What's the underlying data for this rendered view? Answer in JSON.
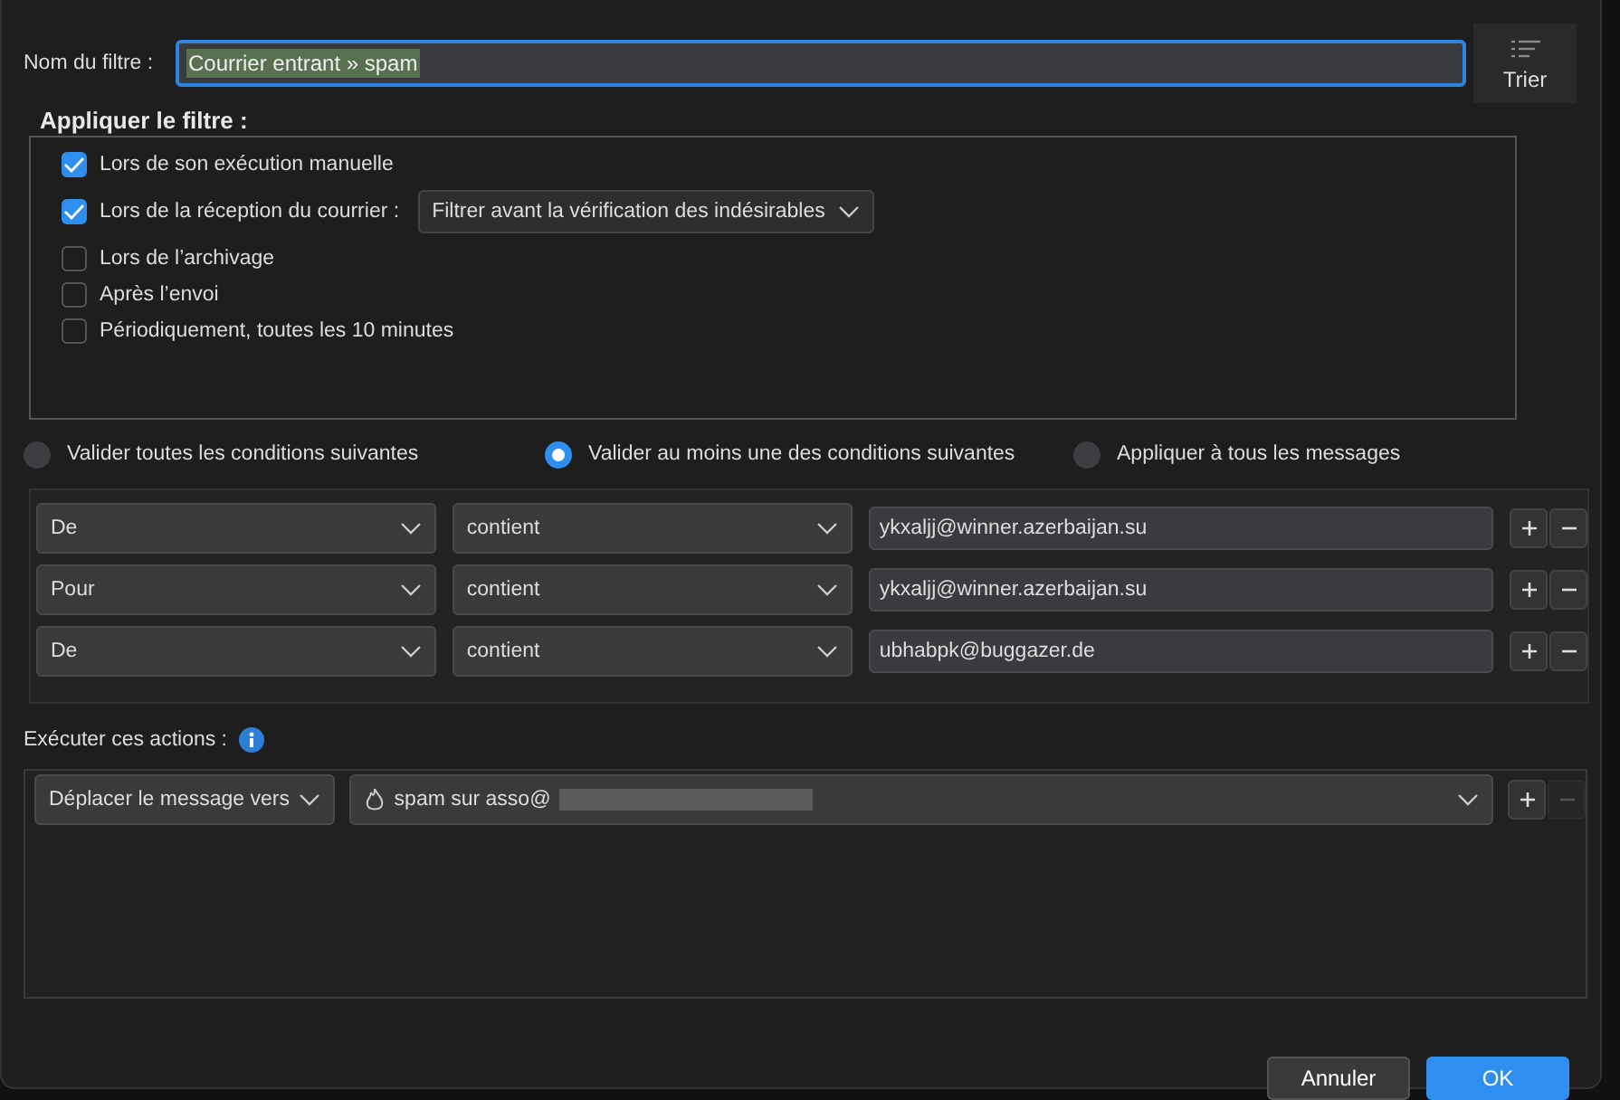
{
  "filter_name": {
    "label": "Nom du filtre :",
    "value": "Courrier entrant » spam"
  },
  "sort_button": {
    "label": "Trier"
  },
  "apply_section": {
    "title": "Appliquer le filtre :",
    "options": [
      {
        "label": "Lors de son exécution manuelle",
        "checked": true
      },
      {
        "label": "Lors de la réception du courrier :",
        "checked": true,
        "dropdown": "Filtrer avant la vérification des indésirables"
      },
      {
        "label": "Lors de l’archivage",
        "checked": false
      },
      {
        "label": "Après l’envoi",
        "checked": false
      },
      {
        "label": "Périodiquement, toutes les 10 minutes",
        "checked": false
      }
    ]
  },
  "match_mode": [
    {
      "label": "Valider toutes les conditions suivantes",
      "selected": false
    },
    {
      "label": "Valider au moins une des conditions suivantes",
      "selected": true
    },
    {
      "label": "Appliquer à tous les messages",
      "selected": false
    }
  ],
  "conditions": [
    {
      "field": "De",
      "operator": "contient",
      "value": "ykxaljj@winner.azerbaijan.su",
      "remove_disabled": false
    },
    {
      "field": "Pour",
      "operator": "contient",
      "value": "ykxaljj@winner.azerbaijan.su",
      "remove_disabled": false
    },
    {
      "field": "De",
      "operator": "contient",
      "value": "ubhabpk@buggazer.de",
      "remove_disabled": false
    }
  ],
  "actions_label": "Exécuter ces actions :",
  "actions": [
    {
      "action": "Déplacer le message vers",
      "target": "spam sur asso@",
      "redacted": true,
      "remove_disabled": true
    }
  ],
  "buttons": [
    {
      "label": "Annuler",
      "kind": "secondary"
    },
    {
      "label": "OK",
      "kind": "primary"
    }
  ]
}
